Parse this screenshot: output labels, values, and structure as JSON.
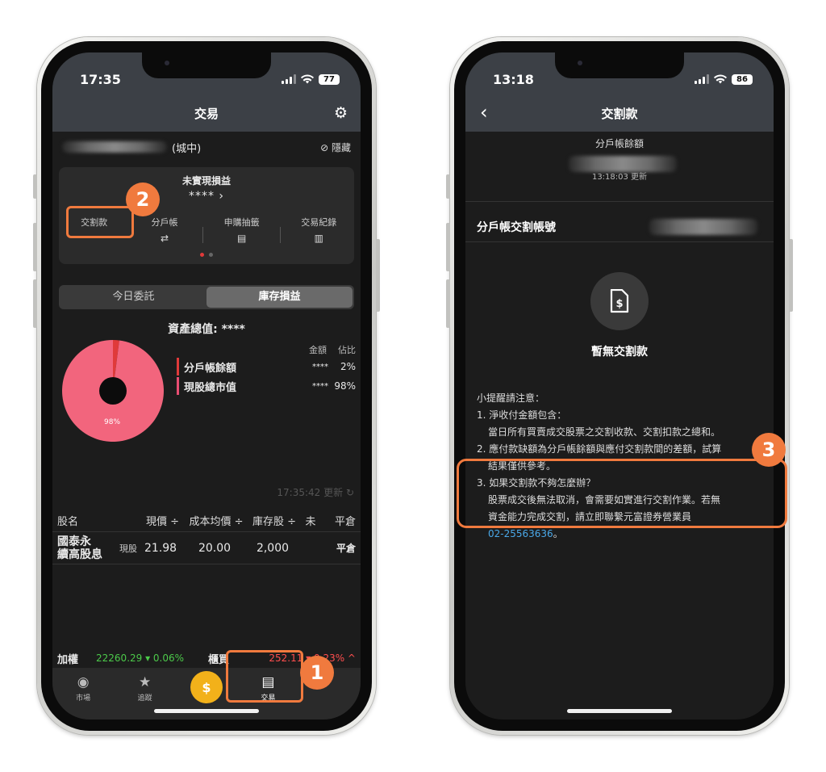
{
  "left": {
    "status": {
      "time": "17:35",
      "battery": "77"
    },
    "nav_title": "交易",
    "account": {
      "suffix": "(城中)",
      "hide_label": "隱藏"
    },
    "summary": {
      "unrealized_label": "未實現損益",
      "unrealized_value": "****",
      "actions": [
        {
          "label": "交割款",
          "icon": ""
        },
        {
          "label": "分戶帳",
          "icon": "⇄"
        },
        {
          "label": "申購抽籤",
          "icon": "▤"
        },
        {
          "label": "交易紀錄",
          "icon": "▥"
        }
      ]
    },
    "segments": [
      "今日委託",
      "庫存損益"
    ],
    "total_assets": "資產總值: ****",
    "legend": {
      "col_amount": "金額",
      "col_pct": "佔比",
      "rows": [
        {
          "name": "分戶帳餘額",
          "amount": "****",
          "pct": "2%"
        },
        {
          "name": "現股總市值",
          "amount": "****",
          "pct": "98%"
        }
      ]
    },
    "pie": {
      "values": [
        2,
        98
      ],
      "colors": [
        "#e03a3a",
        "#f2657d"
      ],
      "label": "98%"
    },
    "updated": "17:35:42 更新",
    "table": {
      "headers": [
        "股名",
        "現價 ÷",
        "成本均價 ÷",
        "庫存股 ÷",
        "未",
        "平倉"
      ],
      "rows": [
        {
          "name_line1": "國泰永",
          "name_line2": "續高股息",
          "type": "現股",
          "price": "21.98",
          "avg_cost": "20.00",
          "shares": "2,000",
          "action": "平倉"
        }
      ]
    },
    "ticker": {
      "taiex_label": "加權",
      "taiex_value": "22260.29 ▾ 0.06%",
      "otc_label": "櫃買",
      "otc_value": "252.11 ▾ 0.23% ^"
    },
    "tabs": [
      {
        "label": "市場",
        "icon": "compass-icon"
      },
      {
        "label": "追蹤",
        "icon": "star-icon"
      },
      {
        "label": "$",
        "icon": "coin-icon"
      },
      {
        "label": "交易",
        "icon": "document-icon"
      },
      {
        "label": "",
        "icon": "more-icon"
      }
    ]
  },
  "right": {
    "status": {
      "time": "13:18",
      "battery": "86"
    },
    "nav_title": "交割款",
    "balance_label": "分戶帳餘額",
    "balance_updated": "13:18:03 更新",
    "subaccount_label": "分戶帳交割帳號",
    "empty_text": "暫無交割款",
    "notes": {
      "title": "小提醒請注意：",
      "n1": "1. 淨收付金額包含：",
      "n1a": "當日所有買賣成交股票之交割收款、交割扣款之總和。",
      "n2": "2. 應付款缺額為分戶帳餘額與應付交割款間的差額，試算",
      "n2a": "結果僅供參考。",
      "n3": "3. 如果交割款不夠怎麼辦？",
      "n3a": "股票成交後無法取消，會需要如實進行交割作業。若無",
      "n3b": "資金能力完成交割，請立即聯繫元富證券營業員",
      "phone": "02-25563636",
      "end": "。"
    }
  },
  "annotations": {
    "b1": "1",
    "b2": "2",
    "b3": "3"
  },
  "colors": {
    "accent_orange": "#f07a3e",
    "header_bg": "#3c4046"
  }
}
